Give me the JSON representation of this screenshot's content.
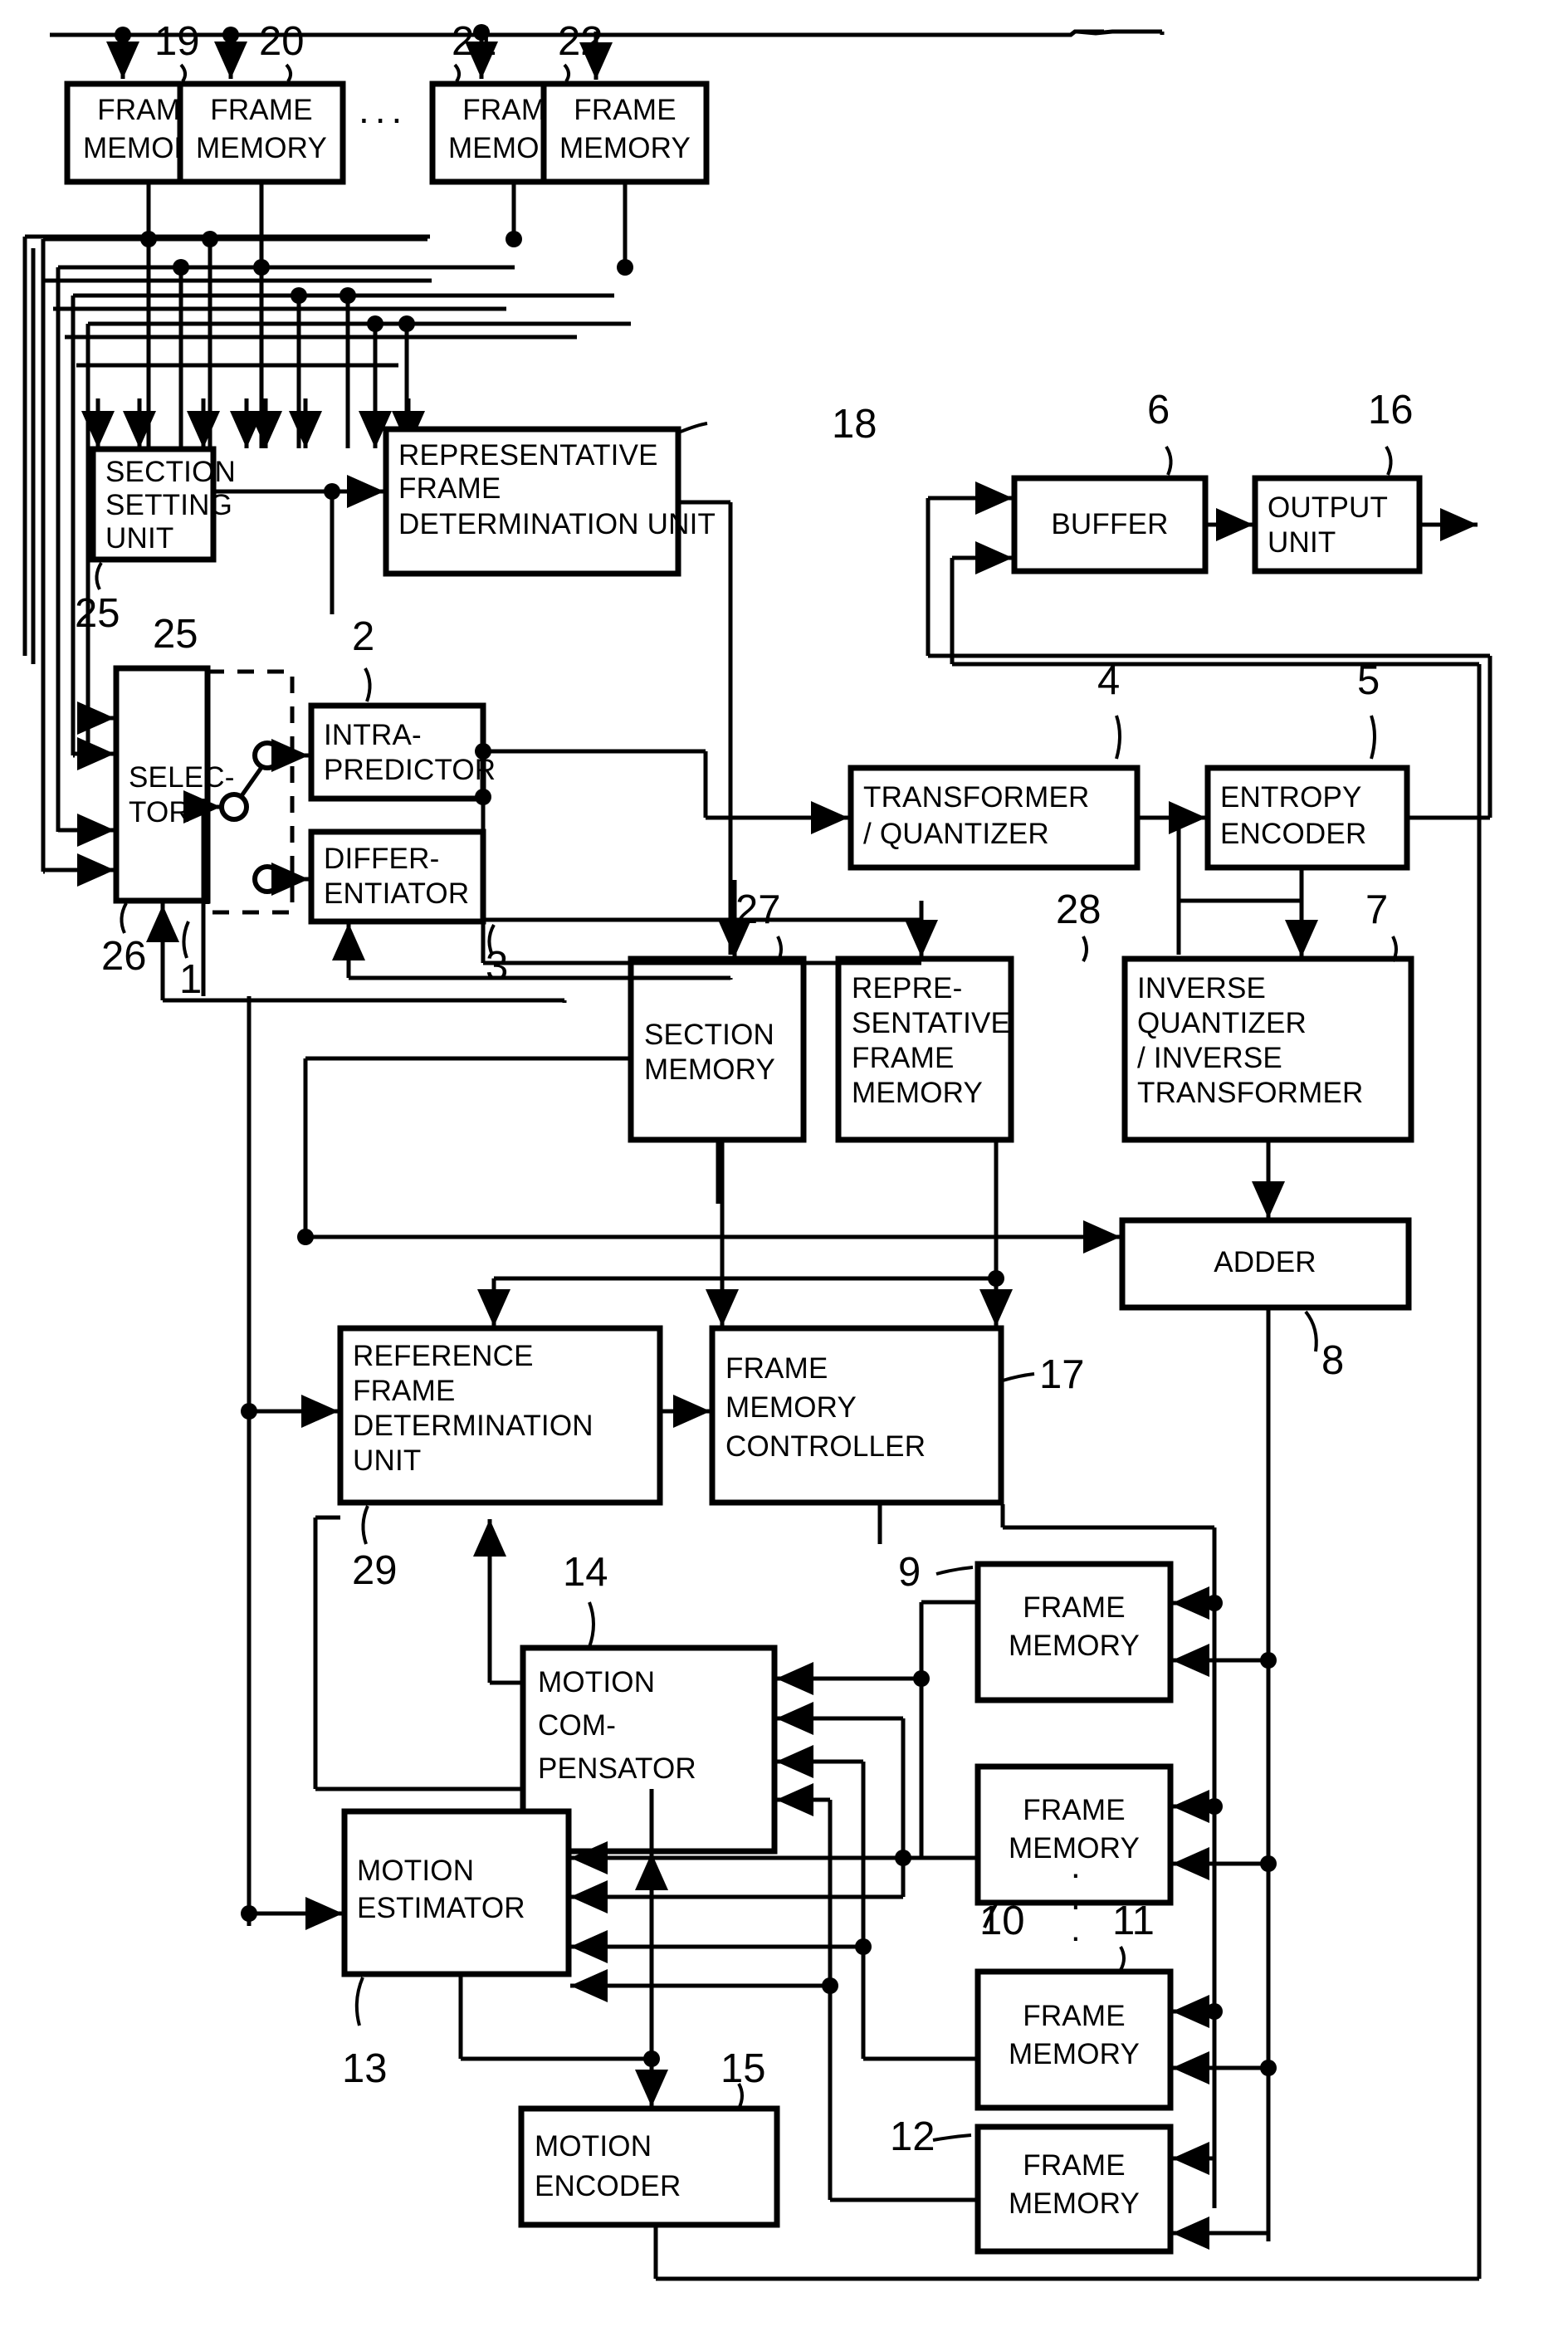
{
  "figure": {
    "kind": "patent-block-diagram",
    "subject": "video encoder block diagram"
  },
  "blocks": [
    {
      "id": "fm19",
      "label": "FRAME\nMEMORY",
      "ref": "19"
    },
    {
      "id": "fm20",
      "label": "FRAME\nMEMORY",
      "ref": "20"
    },
    {
      "id": "fm21",
      "label": "FRAME\nMEMORY",
      "ref": "21"
    },
    {
      "id": "fm22",
      "label": "FRAME\nMEMORY",
      "ref": "22"
    },
    {
      "id": "secset",
      "label": "SECTION\nSETTING\nUNIT",
      "ref": "25"
    },
    {
      "id": "repdet",
      "label": "REPRESENTATIVE\nFRAME\nDETERMINATION  UNIT",
      "ref": "18"
    },
    {
      "id": "buffer",
      "label": "BUFFER",
      "ref": "6"
    },
    {
      "id": "outunit",
      "label": "OUTPUT\nUNIT",
      "ref": "16"
    },
    {
      "id": "selector",
      "label": "SELEC-\nTOR",
      "ref": "26"
    },
    {
      "id": "switch",
      "label": "",
      "ref": "1"
    },
    {
      "id": "intra",
      "label": "INTRA-\nPREDICTOR",
      "ref": "2"
    },
    {
      "id": "diff",
      "label": "DIFFER-\nENTIATOR",
      "ref": "3"
    },
    {
      "id": "tq",
      "label": "TRANSFORMER\n/ QUANTIZER",
      "ref": "4"
    },
    {
      "id": "entropy",
      "label": "ENTROPY\nENCODER",
      "ref": "5"
    },
    {
      "id": "secmem",
      "label": "SECTION\nMEMORY",
      "ref": "27"
    },
    {
      "id": "repmem",
      "label": "REPRE-\nSENTATIVE\nFRAME\nMEMORY",
      "ref": "28"
    },
    {
      "id": "iqit",
      "label": "INVERSE\nQUANTIZER\n/ INVERSE\nTRANSFORMER",
      "ref": "7"
    },
    {
      "id": "adder",
      "label": "ADDER",
      "ref": "8"
    },
    {
      "id": "refdet",
      "label": "REFERENCE\nFRAME\nDETERMINATION\nUNIT",
      "ref": "29"
    },
    {
      "id": "fmctrl",
      "label": "FRAME\nMEMORY\nCONTROLLER",
      "ref": "17"
    },
    {
      "id": "mcomp",
      "label": "MOTION\nCOM-\nPENSATOR",
      "ref": "14"
    },
    {
      "id": "mest",
      "label": "MOTION\nESTIMATOR",
      "ref": "13"
    },
    {
      "id": "menc",
      "label": "MOTION\nENCODER",
      "ref": "15"
    },
    {
      "id": "fm9",
      "label": "FRAME\nMEMORY",
      "ref": "9"
    },
    {
      "id": "fm10",
      "label": "FRAME\nMEMORY",
      "ref": "10"
    },
    {
      "id": "fm11",
      "label": "FRAME\nMEMORY",
      "ref": "11"
    },
    {
      "id": "fm12",
      "label": "FRAME\nMEMORY",
      "ref": "12"
    }
  ],
  "labels": {
    "frame_memory": "FRAME\nMEMORY",
    "frame_memory_l1": "FRAME",
    "frame_memory_l2": "MEMORY",
    "section_setting_l1": "SECTION",
    "section_setting_l2": "SETTING",
    "section_setting_l3": "UNIT",
    "rep_det_l1": "REPRESENTATIVE",
    "rep_det_l2": "FRAME",
    "rep_det_l3": "DETERMINATION  UNIT",
    "buffer": "BUFFER",
    "output_unit_l1": "OUTPUT",
    "output_unit_l2": "UNIT",
    "selector_l1": "SELEC-",
    "selector_l2": "TOR",
    "intra_l1": "INTRA-",
    "intra_l2": "PREDICTOR",
    "diff_l1": "DIFFER-",
    "diff_l2": "ENTIATOR",
    "tq_l1": "TRANSFORMER",
    "tq_l2": "/ QUANTIZER",
    "entropy_l1": "ENTROPY",
    "entropy_l2": "ENCODER",
    "secmem_l1": "SECTION",
    "secmem_l2": "MEMORY",
    "repmem_l1": "REPRE-",
    "repmem_l2": "SENTATIVE",
    "repmem_l3": "FRAME",
    "repmem_l4": "MEMORY",
    "iqit_l1": "INVERSE",
    "iqit_l2": "QUANTIZER",
    "iqit_l3": "/ INVERSE",
    "iqit_l4": "TRANSFORMER",
    "adder": "ADDER",
    "refdet_l1": "REFERENCE",
    "refdet_l2": "FRAME",
    "refdet_l3": "DETERMINATION",
    "refdet_l4": "UNIT",
    "fmctrl_l1": "FRAME",
    "fmctrl_l2": "MEMORY",
    "fmctrl_l3": "CONTROLLER",
    "mcomp_l1": "MOTION",
    "mcomp_l2": "COM-",
    "mcomp_l3": "PENSATOR",
    "mest_l1": "MOTION",
    "mest_l2": "ESTIMATOR",
    "menc_l1": "MOTION",
    "menc_l2": "ENCODER",
    "h_ellipsis": "...",
    "v_ellipsis": "."
  },
  "refnums": {
    "n1": "1",
    "n2": "2",
    "n3": "3",
    "n4": "4",
    "n5": "5",
    "n6": "6",
    "n7": "7",
    "n8": "8",
    "n9": "9",
    "n10": "10",
    "n11": "11",
    "n12": "12",
    "n13": "13",
    "n14": "14",
    "n15": "15",
    "n16": "16",
    "n17": "17",
    "n18": "18",
    "n19": "19",
    "n20": "20",
    "n21": "21",
    "n22": "22",
    "n25": "25",
    "n26": "26",
    "n27": "27",
    "n28": "28",
    "n29": "29"
  },
  "colors": {
    "ink": "#000000",
    "paper": "#ffffff"
  }
}
